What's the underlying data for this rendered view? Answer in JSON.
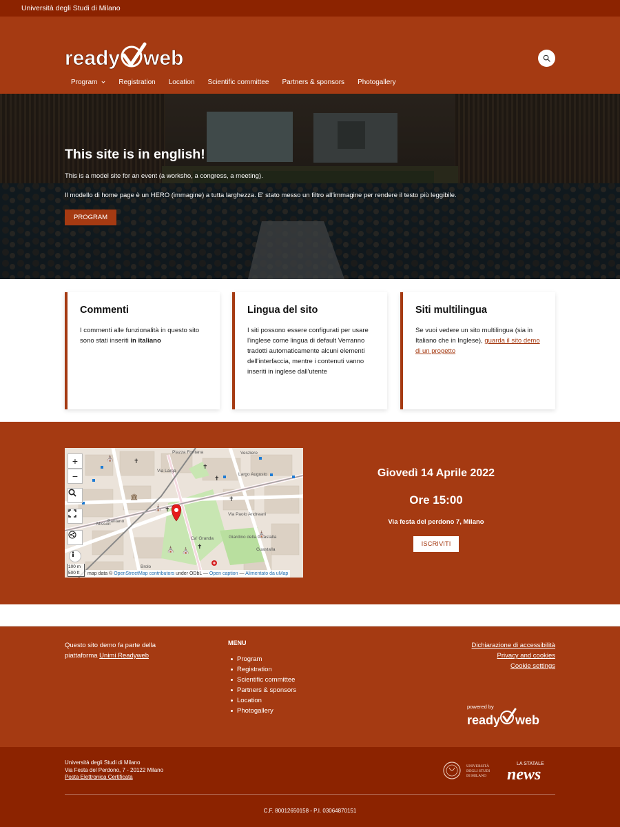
{
  "topbar": {
    "text": "Università degli Studi di Milano"
  },
  "header": {
    "logo_alt": "readyweb",
    "nav": [
      {
        "label": "Program",
        "has_dropdown": true
      },
      {
        "label": "Registration"
      },
      {
        "label": "Location"
      },
      {
        "label": "Scientific committee"
      },
      {
        "label": "Partners & sponsors"
      },
      {
        "label": "Photogallery"
      }
    ]
  },
  "hero": {
    "title": "This site is in english!",
    "p1": "This is a model site for an event (a worksho, a congress, a meeting).",
    "p2": "Il modello di home page è un HERO (immagine) a tutta larghezza. E' stato messo un filtro all'immagine per rendere il testo più leggibile.",
    "button": "PROGRAM"
  },
  "cards": [
    {
      "title": "Commenti",
      "text": "I commenti alle funzionalità in questo sito sono stati inseriti ",
      "bold": "in italiano"
    },
    {
      "title": "Lingua del sito",
      "text": "I siti possono essere configurati per usare l'inglese come lingua di default Verranno tradotti automaticamente alcuni elementi dell'interfaccia, mentre i contenuti vanno inseriti in inglese dall'utente"
    },
    {
      "title": "Siti multilingua",
      "text": "Se vuoi vedere un sito multilingua (sia in Italiano che in Inglese), ",
      "link": "guarda il sito demo di un progetto"
    }
  ],
  "map": {
    "zoom_in": "+",
    "zoom_out": "−",
    "scale_m": "100 m",
    "scale_ft": "500 ft",
    "attribution_prefix": "map data © ",
    "attribution_link": "OpenStreetMap contributors",
    "attribution_mid": " under ODbL — ",
    "attribution_caption": "Open caption",
    "attribution_sep": " — ",
    "attribution_umap": "Alimentato da uMap",
    "labels": [
      "Piazza Fontana",
      "Vesziere",
      "Largo Augusto",
      "Via Larga",
      "Missori",
      "Via Paolo Andreani",
      "Ca' Granda",
      "Giardino della Guastalla",
      "Guastalla",
      "Brolo",
      "Pantano"
    ]
  },
  "event": {
    "date": "Giovedì 14 Aprile 2022",
    "time": "Ore 15:00",
    "address": "Via festa del perdono 7, Milano",
    "button": "ISCRIVITI"
  },
  "footer": {
    "about_text": "Questo sito demo fa parte della piattaforma ",
    "about_link": "Unimi Readyweb",
    "menu_title": "MENU",
    "menu": [
      "Program",
      "Registration",
      "Scientific committee",
      "Partners & sponsors",
      "Location",
      "Photogallery"
    ],
    "links": [
      "Dichiarazione di accessibilità",
      "Privacy and cookies",
      "Cookie settings"
    ],
    "powered_by": "powered by",
    "powered_logo": "readyweb"
  },
  "bottom": {
    "line1": "Università degli Studi di Milano",
    "line2": "Via Festa del Perdono, 7 - 20122 Milano",
    "pec": "Posta Elettronica Certificata",
    "unimi_line1": "UNIVERSITÀ",
    "unimi_line2": "DEGLI STUDI",
    "unimi_line3": "DI MILANO",
    "news_top": "LA STATALE",
    "news_main": "news",
    "cf": "C.F. 80012650158 - P.I. 03064870151"
  },
  "colors": {
    "brand": "#a53a12",
    "brand_dark": "#8c2300"
  }
}
